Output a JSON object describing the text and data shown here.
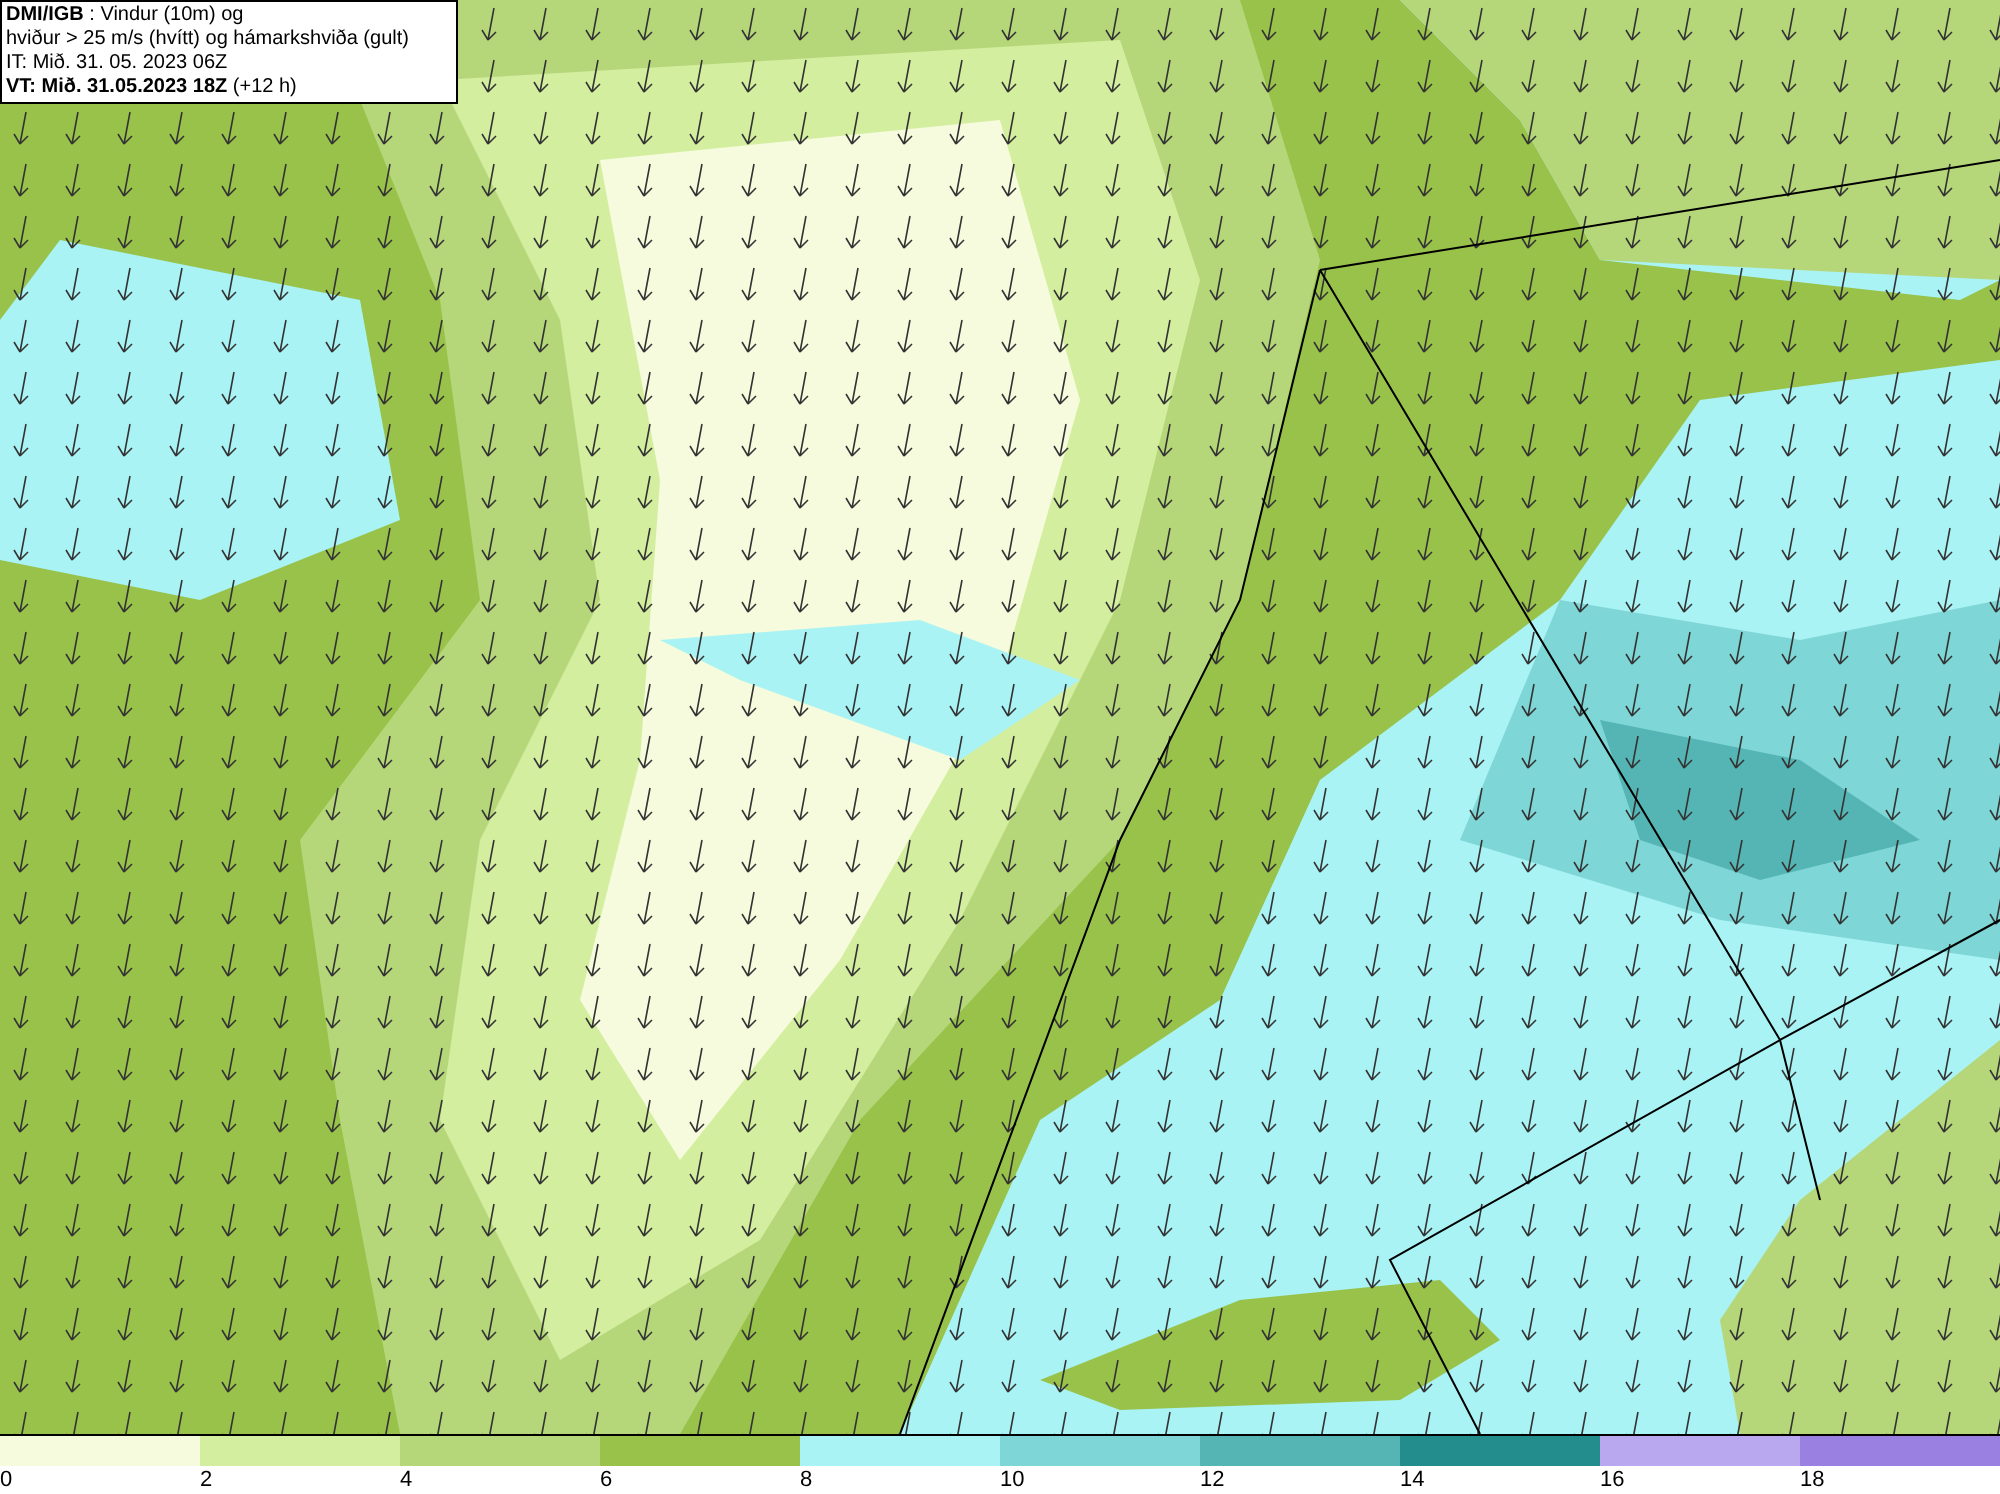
{
  "header": {
    "lines": [
      "**DMI/IGB** : Vindur (10m) og",
      "hviður > 25 m/s (hvítt) og hámarkshviða (gult)",
      "IT: Mið. 31. 05. 2023 06Z",
      "**VT: Mið. 31.05.2023 18Z** (+12 h)"
    ]
  },
  "legend": {
    "bins": [
      {
        "color": "#f5fbdc"
      },
      {
        "color": "#d4eea0"
      },
      {
        "color": "#b5d77a"
      },
      {
        "color": "#98c24a"
      },
      {
        "color": "#aaf3f5"
      },
      {
        "color": "#7fd6d6"
      },
      {
        "color": "#55b5b5"
      },
      {
        "color": "#238c8c"
      },
      {
        "color": "#b9a8f0"
      },
      {
        "color": "#9a80e0"
      }
    ],
    "labels": [
      "0",
      "2",
      "4",
      "6",
      "8",
      "10",
      "12",
      "14",
      "16",
      "18"
    ]
  }
}
